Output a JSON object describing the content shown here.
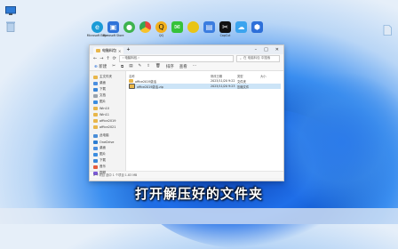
{
  "desktop": {
    "left_icons": [
      {
        "label": "",
        "icon": "monitor-icon",
        "color": "#2e7bd6"
      },
      {
        "label": "",
        "icon": "recycle-bin-icon",
        "color": "#7aa6d8"
      }
    ],
    "right_icon": {
      "label": "",
      "icon": "file-icon",
      "color": "#6fa0d0"
    }
  },
  "top_icons": [
    {
      "label": "Microsoft Edge",
      "icon": "edge-icon",
      "color": "#1a9bd7"
    },
    {
      "label": "Microsoft Store",
      "icon": "store-icon",
      "color": "#2f73d9"
    },
    {
      "label": "",
      "icon": "green-app-icon",
      "color": "#3eb34f"
    },
    {
      "label": "",
      "icon": "chrome-icon",
      "color": "#e8453c"
    },
    {
      "label": "QQ",
      "icon": "qq-icon",
      "color": "#f2b01e"
    },
    {
      "label": "",
      "icon": "wechat-icon",
      "color": "#35c23a"
    },
    {
      "label": "",
      "icon": "yellow-app-icon",
      "color": "#e9c416"
    },
    {
      "label": "",
      "icon": "app-icon",
      "color": "#3b7de0"
    },
    {
      "label": "CapCut",
      "icon": "capcut-icon",
      "color": "#111111"
    },
    {
      "label": "",
      "icon": "cloud-icon",
      "color": "#3aa4ef"
    },
    {
      "label": "",
      "icon": "blue-app-icon",
      "color": "#2d6fd9"
    }
  ],
  "explorer": {
    "tab_title": "电脑料包",
    "address": "› 电脑料包 ›",
    "search_placeholder": "在 电脑料包 中搜索",
    "toolbar": {
      "new": "新建",
      "sort": "排序",
      "view": "查看",
      "more": "···"
    },
    "sidebar": [
      {
        "label": "主文件夹",
        "color": "#e8b64a"
      },
      {
        "label": "桌面",
        "color": "#4b8fe0"
      },
      {
        "label": "下载",
        "color": "#3a86d8"
      },
      {
        "label": "文档",
        "color": "#9aa3ad"
      },
      {
        "label": "图片",
        "color": "#3b8de0"
      },
      {
        "label": "Win10",
        "color": "#e8b64a"
      },
      {
        "label": "Win11",
        "color": "#e8b64a"
      },
      {
        "label": "office2019",
        "color": "#e8b64a"
      },
      {
        "label": "office2021",
        "color": "#e8b64a"
      },
      {
        "label": "此电脑",
        "color": "#4a8ed8"
      },
      {
        "label": "OneDrive",
        "color": "#2d7dd2"
      },
      {
        "label": "桌面",
        "color": "#4b8fe0"
      },
      {
        "label": "图片",
        "color": "#3b8de0"
      },
      {
        "label": "下载",
        "color": "#3a86d8"
      },
      {
        "label": "音乐",
        "color": "#e55b3c"
      },
      {
        "label": "视频",
        "color": "#7c5ad9"
      }
    ],
    "columns": [
      "名称",
      "修改日期",
      "类型",
      "大小"
    ],
    "files": [
      {
        "name": "office2019激活",
        "date": "2023/11/20 9:22",
        "type": "文件夹",
        "size": "",
        "color": "#e8b64a",
        "selected": false
      },
      {
        "name": "office2019激活.zip",
        "date": "2023/11/20 9:23",
        "type": "压缩文件",
        "size": "",
        "color": "#e8b64a",
        "selected": true
      }
    ],
    "status": "2 个项目   选中 1 个项目  1.83 MB"
  },
  "subtitle": "打开解压好的文件夹"
}
